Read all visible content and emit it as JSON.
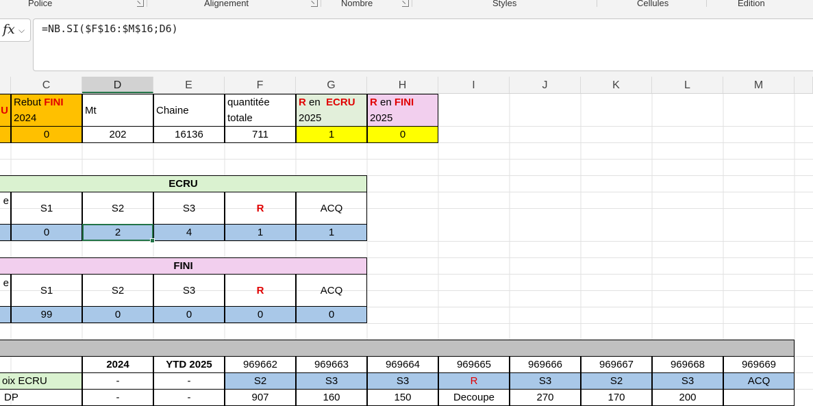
{
  "ribbon": {
    "groups": [
      "Police",
      "Alignement",
      "Nombre",
      "Styles",
      "Cellules",
      "Edition"
    ]
  },
  "formula_bar": {
    "fx_label": "fx",
    "chevron": "⌵",
    "formula": "=NB.SI($F$16:$M$16;D6)"
  },
  "columns": [
    "C",
    "D",
    "E",
    "F",
    "G",
    "H",
    "I",
    "J",
    "K",
    "L",
    "M"
  ],
  "selected_column": "D",
  "top_table": {
    "cut_text": "U",
    "rebut": {
      "prefix": "Rebut ",
      "red": "FINI",
      "year": "2024"
    },
    "mt": "Mt",
    "chaine": "Chaine",
    "quantite": {
      "line1": "quantitée",
      "line2": "totale"
    },
    "r_ecru": {
      "r": "R",
      "mid": " en ",
      "red": "ECRU",
      "year": "2025"
    },
    "r_fini": {
      "r": "R",
      "mid": " en ",
      "red": "FINI",
      "year": "2025"
    },
    "values": [
      "0",
      "202",
      "16136",
      "711",
      "1",
      "0"
    ]
  },
  "ecru_table": {
    "title": "ECRU",
    "cut_text": "e",
    "headers": [
      "S1",
      "S2",
      "S3",
      "R",
      "ACQ"
    ],
    "values": [
      "0",
      "2",
      "4",
      "1",
      "1"
    ]
  },
  "fini_table": {
    "title": "FINI",
    "cut_text": "e",
    "headers": [
      "S1",
      "S2",
      "S3",
      "R",
      "ACQ"
    ],
    "values": [
      "99",
      "0",
      "0",
      "0",
      "0"
    ]
  },
  "bottom_table": {
    "headers": [
      "2024",
      "YTD 2025",
      "969662",
      "969663",
      "969664",
      "969665",
      "969666",
      "969667",
      "969668",
      "969669"
    ],
    "row1_label": "oix ECRU",
    "row1": [
      "-",
      "-",
      "S2",
      "S3",
      "S3",
      "R",
      "S3",
      "S2",
      "S3",
      "ACQ"
    ],
    "row2_label": "DP",
    "row2": [
      "-",
      "-",
      "907",
      "160",
      "150",
      "Decoupe",
      "270",
      "170",
      "200",
      ""
    ]
  },
  "colors": {
    "accent": "#217346",
    "orange": "#ffc000",
    "yellow": "#ffff00",
    "green": "#e2efda",
    "pink": "#f2cfee",
    "blue": "#a9c8e8",
    "red": "#e00000"
  }
}
